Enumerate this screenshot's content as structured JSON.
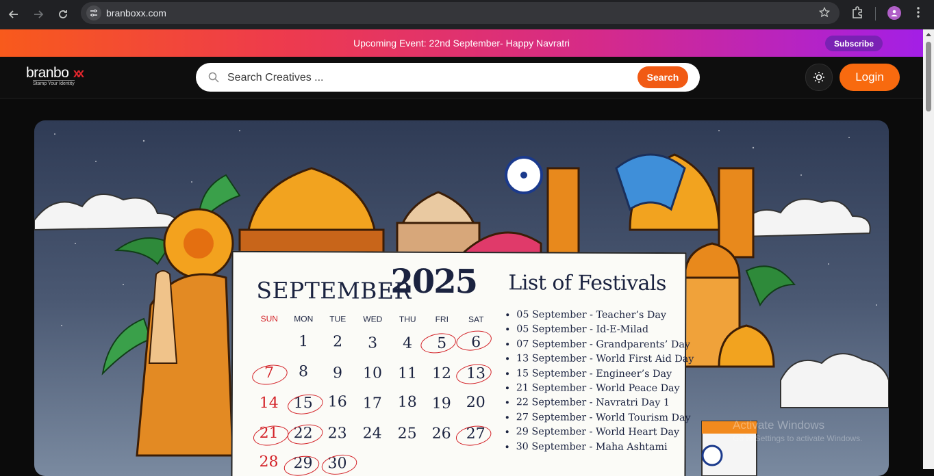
{
  "browser": {
    "url": "branboxx.com"
  },
  "announcement": {
    "text": "Upcoming Event: 22nd September- Happy Navratri",
    "subscribe_label": "Subscribe"
  },
  "header": {
    "logo_text": "branbo",
    "logo_accent": "xx",
    "logo_tagline": "Stamp Your Identity",
    "search_placeholder": "Search Creatives ...",
    "search_button": "Search",
    "login_label": "Login"
  },
  "banner": {
    "month": "SEPTEMBER",
    "year": "2025",
    "weekdays": [
      "SUN",
      "MON",
      "TUE",
      "WED",
      "THU",
      "FRI",
      "SAT"
    ],
    "days": [
      "1",
      "2",
      "3",
      "4",
      "5",
      "6",
      "7",
      "8",
      "9",
      "10",
      "11",
      "12",
      "13",
      "14",
      "15",
      "16",
      "17",
      "18",
      "19",
      "20",
      "21",
      "22",
      "23",
      "24",
      "25",
      "26",
      "27",
      "28",
      "29",
      "30"
    ],
    "festivals_title": "List of Festivals",
    "festivals": [
      "05 September - Teacher’s Day",
      "05 September -  Id-E-Milad",
      "07 September -  Grandparents’ Day",
      "13 September -  World First Aid Day",
      "15 September -  Engineer’s Day",
      "21 September -  World Peace Day",
      "22 September -  Navratri Day 1",
      "27 September -  World Tourism Day",
      "29 September - World Heart Day",
      "30 September - Maha Ashtami"
    ]
  },
  "colors": {
    "accent_orange": "#f86a0f",
    "holiday_red": "#d32127",
    "subscribe_purple": "#7a21b4"
  },
  "overlay": {
    "line1": "Activate Windows",
    "line2": "Go to Settings to activate Windows."
  }
}
